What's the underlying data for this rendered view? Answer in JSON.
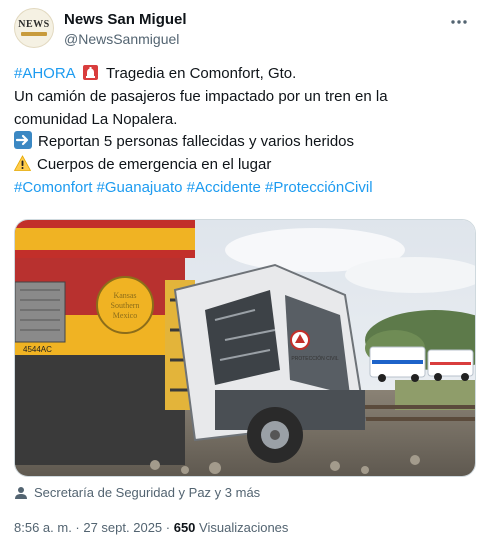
{
  "account": {
    "display_name": "News San Miguel",
    "handle": "@NewsSanmiguel",
    "avatar_text": "NEWS"
  },
  "more_label": "···",
  "tweet": {
    "line1_tag": "#AHORA",
    "line1_text": "Tragedia en Comonfort, Gto.",
    "line2": "Un camión de pasajeros fue impactado por un tren en la",
    "line3": "comunidad La Nopalera.",
    "line4": "Reportan 5 personas fallecidas y varios heridos",
    "line5": "Cuerpos de emergencia en el lugar",
    "hashtags": [
      "#Comonfort",
      "#Guanajuato",
      "#Accidente",
      "#ProtecciónCivil"
    ]
  },
  "icons": {
    "siren": "rotating-light-icon",
    "arrow": "right-arrow-icon",
    "warning": "warning-icon",
    "person": "person-icon",
    "more": "more-options-icon"
  },
  "media": {
    "locomotive_label_1": "Kansas",
    "locomotive_label_2": "Southern",
    "locomotive_label_3": "Mexico",
    "unit_number": "4544AC",
    "bus_emblem": "PROTECCIÓN CIVIL"
  },
  "tagged": "Secretaría de Seguridad y Paz y 3 más",
  "meta": {
    "timestamp": "8:56 a. m. · 27 sept. 2025 ·",
    "views_count": "650",
    "views_label": "Visualizaciones"
  },
  "colors": {
    "link": "#1d9bf0",
    "secondary": "#536471",
    "locomotive_red": "#b8312f",
    "locomotive_yellow": "#f0b323"
  }
}
